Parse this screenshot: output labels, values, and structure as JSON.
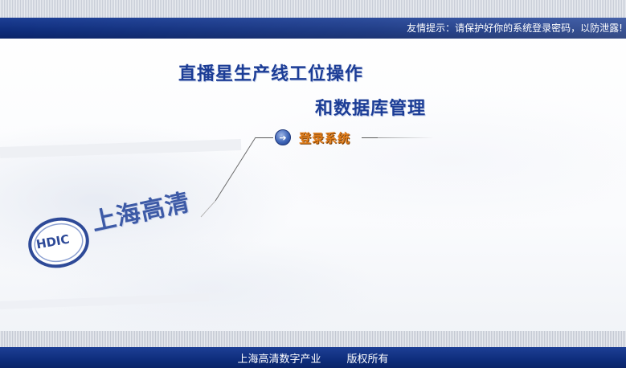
{
  "header": {
    "tip": "友情提示：请保护好你的系统登录密码，以防泄露!"
  },
  "titles": {
    "line1": "直播星生产线工位操作",
    "line2": "和数据库管理"
  },
  "login": {
    "label": "登录系统",
    "icon": "arrow-right-circle-icon"
  },
  "logo": {
    "cn": "上海高清",
    "en": "HDIC"
  },
  "footer": {
    "company": "上海高清数字产业",
    "rights": "版权所有"
  },
  "colors": {
    "brand_blue": "#0e2d7c",
    "title_blue": "#1c3d96",
    "login_orange": "#e07c1a"
  }
}
